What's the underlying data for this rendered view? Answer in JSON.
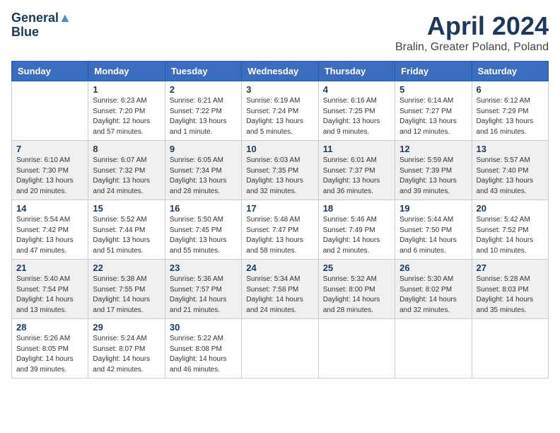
{
  "header": {
    "logo": {
      "line1": "General",
      "line2": "Blue"
    },
    "title": "April 2024",
    "location": "Bralin, Greater Poland, Poland"
  },
  "days_of_week": [
    "Sunday",
    "Monday",
    "Tuesday",
    "Wednesday",
    "Thursday",
    "Friday",
    "Saturday"
  ],
  "weeks": [
    [
      {
        "day": "",
        "sunrise": "",
        "sunset": "",
        "daylight": ""
      },
      {
        "day": "1",
        "sunrise": "Sunrise: 6:23 AM",
        "sunset": "Sunset: 7:20 PM",
        "daylight": "Daylight: 12 hours and 57 minutes."
      },
      {
        "day": "2",
        "sunrise": "Sunrise: 6:21 AM",
        "sunset": "Sunset: 7:22 PM",
        "daylight": "Daylight: 13 hours and 1 minute."
      },
      {
        "day": "3",
        "sunrise": "Sunrise: 6:19 AM",
        "sunset": "Sunset: 7:24 PM",
        "daylight": "Daylight: 13 hours and 5 minutes."
      },
      {
        "day": "4",
        "sunrise": "Sunrise: 6:16 AM",
        "sunset": "Sunset: 7:25 PM",
        "daylight": "Daylight: 13 hours and 9 minutes."
      },
      {
        "day": "5",
        "sunrise": "Sunrise: 6:14 AM",
        "sunset": "Sunset: 7:27 PM",
        "daylight": "Daylight: 13 hours and 12 minutes."
      },
      {
        "day": "6",
        "sunrise": "Sunrise: 6:12 AM",
        "sunset": "Sunset: 7:29 PM",
        "daylight": "Daylight: 13 hours and 16 minutes."
      }
    ],
    [
      {
        "day": "7",
        "sunrise": "Sunrise: 6:10 AM",
        "sunset": "Sunset: 7:30 PM",
        "daylight": "Daylight: 13 hours and 20 minutes."
      },
      {
        "day": "8",
        "sunrise": "Sunrise: 6:07 AM",
        "sunset": "Sunset: 7:32 PM",
        "daylight": "Daylight: 13 hours and 24 minutes."
      },
      {
        "day": "9",
        "sunrise": "Sunrise: 6:05 AM",
        "sunset": "Sunset: 7:34 PM",
        "daylight": "Daylight: 13 hours and 28 minutes."
      },
      {
        "day": "10",
        "sunrise": "Sunrise: 6:03 AM",
        "sunset": "Sunset: 7:35 PM",
        "daylight": "Daylight: 13 hours and 32 minutes."
      },
      {
        "day": "11",
        "sunrise": "Sunrise: 6:01 AM",
        "sunset": "Sunset: 7:37 PM",
        "daylight": "Daylight: 13 hours and 36 minutes."
      },
      {
        "day": "12",
        "sunrise": "Sunrise: 5:59 AM",
        "sunset": "Sunset: 7:39 PM",
        "daylight": "Daylight: 13 hours and 39 minutes."
      },
      {
        "day": "13",
        "sunrise": "Sunrise: 5:57 AM",
        "sunset": "Sunset: 7:40 PM",
        "daylight": "Daylight: 13 hours and 43 minutes."
      }
    ],
    [
      {
        "day": "14",
        "sunrise": "Sunrise: 5:54 AM",
        "sunset": "Sunset: 7:42 PM",
        "daylight": "Daylight: 13 hours and 47 minutes."
      },
      {
        "day": "15",
        "sunrise": "Sunrise: 5:52 AM",
        "sunset": "Sunset: 7:44 PM",
        "daylight": "Daylight: 13 hours and 51 minutes."
      },
      {
        "day": "16",
        "sunrise": "Sunrise: 5:50 AM",
        "sunset": "Sunset: 7:45 PM",
        "daylight": "Daylight: 13 hours and 55 minutes."
      },
      {
        "day": "17",
        "sunrise": "Sunrise: 5:48 AM",
        "sunset": "Sunset: 7:47 PM",
        "daylight": "Daylight: 13 hours and 58 minutes."
      },
      {
        "day": "18",
        "sunrise": "Sunrise: 5:46 AM",
        "sunset": "Sunset: 7:49 PM",
        "daylight": "Daylight: 14 hours and 2 minutes."
      },
      {
        "day": "19",
        "sunrise": "Sunrise: 5:44 AM",
        "sunset": "Sunset: 7:50 PM",
        "daylight": "Daylight: 14 hours and 6 minutes."
      },
      {
        "day": "20",
        "sunrise": "Sunrise: 5:42 AM",
        "sunset": "Sunset: 7:52 PM",
        "daylight": "Daylight: 14 hours and 10 minutes."
      }
    ],
    [
      {
        "day": "21",
        "sunrise": "Sunrise: 5:40 AM",
        "sunset": "Sunset: 7:54 PM",
        "daylight": "Daylight: 14 hours and 13 minutes."
      },
      {
        "day": "22",
        "sunrise": "Sunrise: 5:38 AM",
        "sunset": "Sunset: 7:55 PM",
        "daylight": "Daylight: 14 hours and 17 minutes."
      },
      {
        "day": "23",
        "sunrise": "Sunrise: 5:36 AM",
        "sunset": "Sunset: 7:57 PM",
        "daylight": "Daylight: 14 hours and 21 minutes."
      },
      {
        "day": "24",
        "sunrise": "Sunrise: 5:34 AM",
        "sunset": "Sunset: 7:58 PM",
        "daylight": "Daylight: 14 hours and 24 minutes."
      },
      {
        "day": "25",
        "sunrise": "Sunrise: 5:32 AM",
        "sunset": "Sunset: 8:00 PM",
        "daylight": "Daylight: 14 hours and 28 minutes."
      },
      {
        "day": "26",
        "sunrise": "Sunrise: 5:30 AM",
        "sunset": "Sunset: 8:02 PM",
        "daylight": "Daylight: 14 hours and 32 minutes."
      },
      {
        "day": "27",
        "sunrise": "Sunrise: 5:28 AM",
        "sunset": "Sunset: 8:03 PM",
        "daylight": "Daylight: 14 hours and 35 minutes."
      }
    ],
    [
      {
        "day": "28",
        "sunrise": "Sunrise: 5:26 AM",
        "sunset": "Sunset: 8:05 PM",
        "daylight": "Daylight: 14 hours and 39 minutes."
      },
      {
        "day": "29",
        "sunrise": "Sunrise: 5:24 AM",
        "sunset": "Sunset: 8:07 PM",
        "daylight": "Daylight: 14 hours and 42 minutes."
      },
      {
        "day": "30",
        "sunrise": "Sunrise: 5:22 AM",
        "sunset": "Sunset: 8:08 PM",
        "daylight": "Daylight: 14 hours and 46 minutes."
      },
      {
        "day": "",
        "sunrise": "",
        "sunset": "",
        "daylight": ""
      },
      {
        "day": "",
        "sunrise": "",
        "sunset": "",
        "daylight": ""
      },
      {
        "day": "",
        "sunrise": "",
        "sunset": "",
        "daylight": ""
      },
      {
        "day": "",
        "sunrise": "",
        "sunset": "",
        "daylight": ""
      }
    ]
  ]
}
